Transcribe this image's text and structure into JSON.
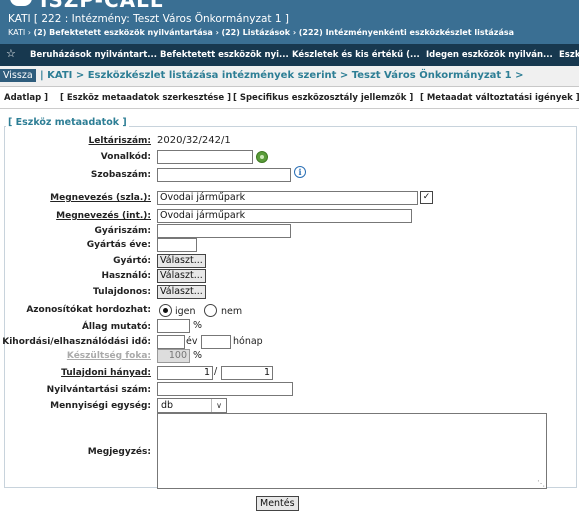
{
  "header": {
    "logo_text": "ISZP-CALL",
    "title": "KATI [ 222 : Intézmény: Teszt Város Önkormányzat 1 ]",
    "crumb_prefix": "KATI ›",
    "crumb_1": "(2) Befektetett eszközök nyilvántartása ›",
    "crumb_2": "(22) Listázások ›",
    "crumb_3": "(222) Intézményenkénti eszközkészlet listázása"
  },
  "menu": {
    "star": "☆",
    "items": [
      "Beruházások nyilvántart...",
      "Befektetett eszközök nyi...",
      "Készletek és kis értékű (...",
      "Idegen eszközök nyilván...",
      "Eszk"
    ]
  },
  "breadcrumb": {
    "back": "Vissza",
    "path": "| KATI > Eszközkészlet listázása intézmények szerint > Teszt Város Önkormányzat 1 >"
  },
  "tabs": [
    "Adatlap ]",
    "[ Eszköz metaadatok szerkesztése ]",
    "[ Specifikus eszközosztály jellemzők ]",
    "[ Metaadat változtatási igények ]"
  ],
  "form": {
    "legend": "[ Eszköz metaadatok ]",
    "leltariszam_label": "Leltáriszám:",
    "leltariszam_value": "2020/32/242/1",
    "vonalkod_label": "Vonalkód:",
    "vonalkod_value": "",
    "szobaszam_label": "Szobaszám:",
    "szobaszam_value": "",
    "megnev_szla_label": "Megnevezés (szla.):",
    "megnev_szla_value": "Óvodai járműpark",
    "megnev_szla_checked": "✓",
    "megnev_int_label": "Megnevezés (int.):",
    "megnev_int_value": "Óvodai járműpark",
    "gyariszam_label": "Gyáriszám:",
    "gyartas_eve_label": "Gyártás éve:",
    "gyarto_label": "Gyártó:",
    "hasznalo_label": "Használó:",
    "tulajdonos_label": "Tulajdonos:",
    "choose_label": "Választ...",
    "azonosito_label": "Azonosítókat hordozhat:",
    "igen_label": "igen",
    "nem_label": "nem",
    "allag_label": "Állag mutató:",
    "percent": "%",
    "kihordasi_label": "Kihordási/elhasználódási idő:",
    "ev_label": "év",
    "honap_label": "hónap",
    "keszultseg_label": "Készültség foka:",
    "keszultseg_value": "100",
    "tulajdoni_label": "Tulajdoni hányad:",
    "tulajdoni_num": "1",
    "tulajdoni_sep": "/",
    "tulajdoni_den": "1",
    "nyilv_label": "Nyilvántartási szám:",
    "mennyisegi_label": "Mennyiségi egység:",
    "mennyisegi_value": "db",
    "megjegyzes_label": "Megjegyzés:",
    "save_label": "Mentés"
  }
}
